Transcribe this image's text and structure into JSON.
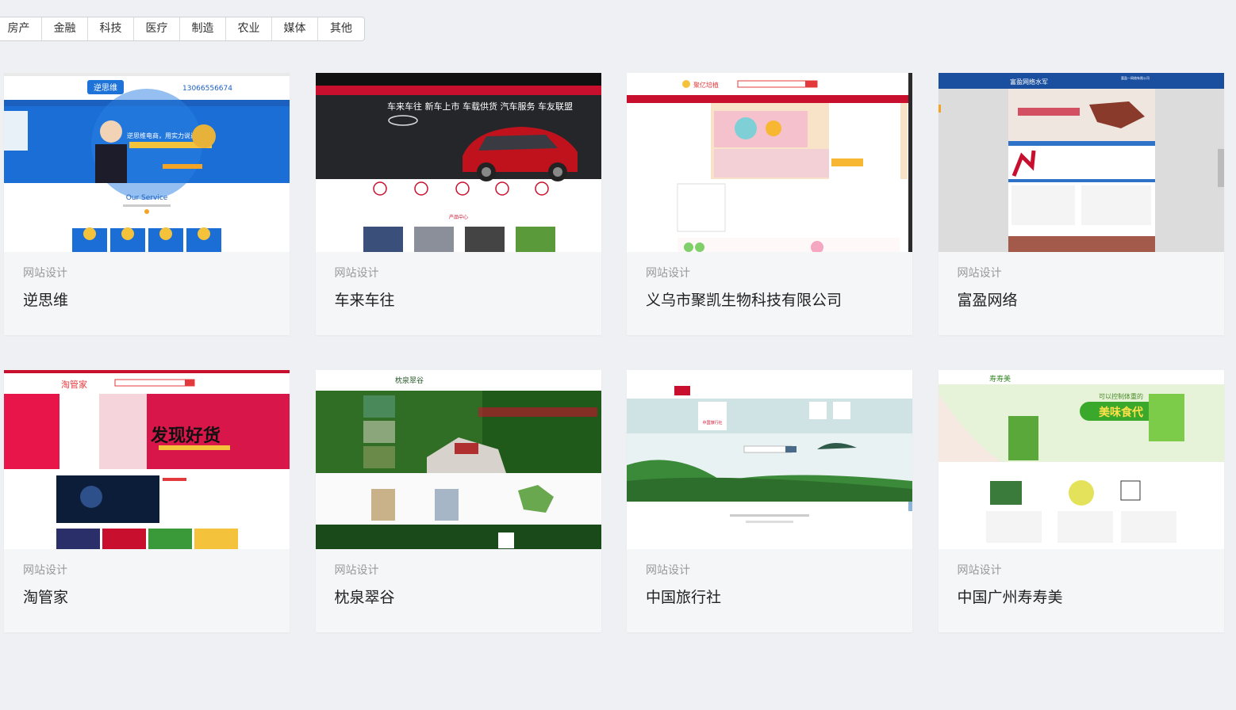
{
  "filters": [
    "房产",
    "金融",
    "科技",
    "医疗",
    "制造",
    "农业",
    "媒体",
    "其他"
  ],
  "cards": [
    {
      "category": "网站设计",
      "title": "逆思维",
      "thumb_texts": [
        "逆思维",
        "13066556674",
        "逆思维电商，用实力说话",
        "Our Service"
      ]
    },
    {
      "category": "网站设计",
      "title": "车来车往",
      "thumb_texts": [
        "车来车往  新车上市  车载供货  汽车服务  车友联盟",
        "产品中心"
      ]
    },
    {
      "category": "网站设计",
      "title": "义乌市聚凯生物科技有限公司",
      "thumb_texts": [
        "聚亿培植"
      ]
    },
    {
      "category": "网站设计",
      "title": "富盈网络",
      "thumb_texts": [
        "富盈网络水军",
        "富盈一网络有限公司"
      ]
    },
    {
      "category": "网站设计",
      "title": "淘管家",
      "thumb_texts": [
        "淘管家",
        "发现好货"
      ]
    },
    {
      "category": "网站设计",
      "title": "枕泉翠谷",
      "thumb_texts": [
        "枕泉翠谷"
      ]
    },
    {
      "category": "网站设计",
      "title": "中国旅行社",
      "thumb_texts": [
        "中国旅行社"
      ]
    },
    {
      "category": "网站设计",
      "title": "中国广州寿寿美",
      "thumb_texts": [
        "寿寿美",
        "可以控制体重的",
        "美味食代"
      ]
    }
  ],
  "colors": {
    "page_bg": "#eef0f3",
    "card_bg": "#f5f6f8",
    "filter_border": "#cfd3d8"
  }
}
